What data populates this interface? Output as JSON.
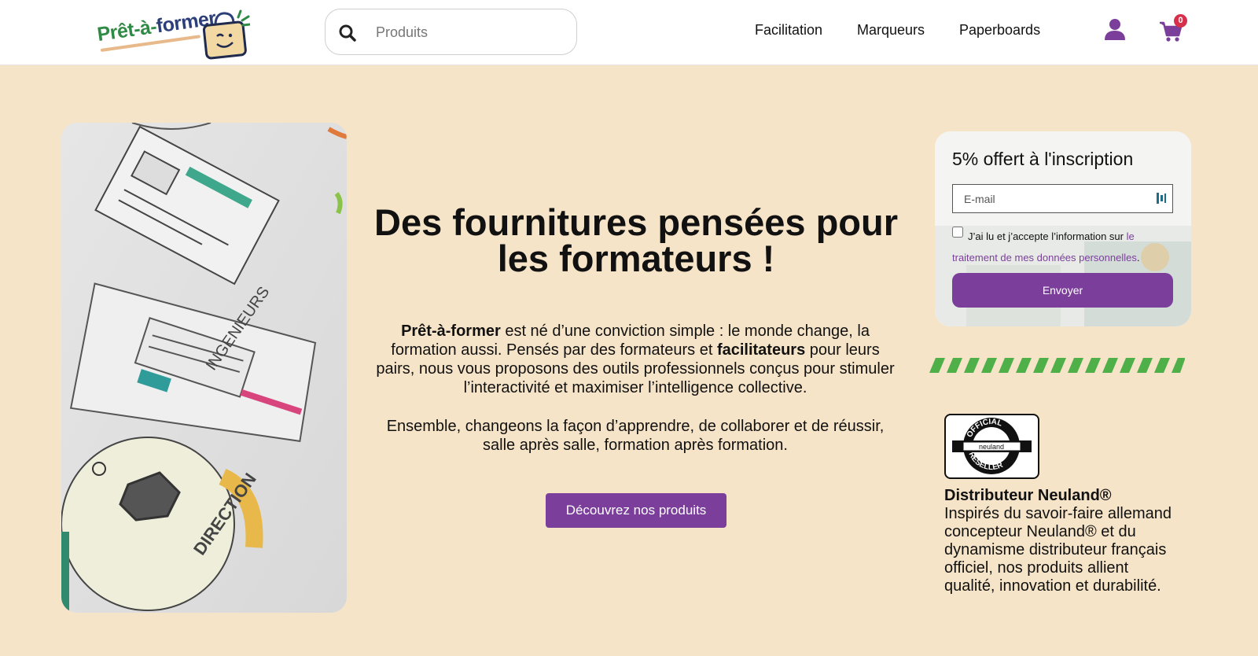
{
  "header": {
    "logo": {
      "text_main": "Prêt-à-",
      "text_accent": "former"
    },
    "search": {
      "placeholder": "Produits"
    },
    "nav": [
      {
        "label": "Facilitation"
      },
      {
        "label": "Marqueurs"
      },
      {
        "label": "Paperboards"
      }
    ],
    "cart": {
      "count": "0"
    },
    "icons": [
      "search-icon",
      "user-icon",
      "cart-icon"
    ]
  },
  "hero": {
    "title": "Des fournitures pensées pour les formateurs !",
    "desc": {
      "brand": "Prêt-à-former",
      "part1": " est né d’une conviction simple : le monde change, la formation aussi. Pensés par des formateurs et ",
      "bold2": "facilitateurs",
      "part2": " pour leurs pairs, nous vous proposons des outils professionnels conçus pour stimuler l’interactivité et maximiser l’intelligence collective."
    },
    "desc2": "Ensemble, changeons la façon d’apprendre, de collaborer et de réussir, salle après salle, formation après formation.",
    "cta_label": "Découvrez nos produits"
  },
  "newsletter": {
    "title": "5% offert à l'inscription",
    "email_placeholder": "E-mail",
    "consent_text": "J’ai lu et j’accepte l’information sur ",
    "consent_link": "le traitement de mes données personnelles",
    "consent_end": ".",
    "submit_label": "Envoyer"
  },
  "neuland": {
    "badge_top": "OFFICIAL",
    "badge_mid": "neuland",
    "badge_bottom": "RESELLER",
    "title": "Distributeur Neuland®",
    "text": "Inspirés du savoir-faire allemand concepteur Neuland® et du dynamisme distributeur français officiel, nos produits allient qualité, innovation et durabilité."
  },
  "colors": {
    "background": "#f6e4c8",
    "accent_purple": "#7b3f9b",
    "logo_green": "#2f8a46",
    "stripe_green": "#4fb04a",
    "badge_red": "#d6304c"
  }
}
